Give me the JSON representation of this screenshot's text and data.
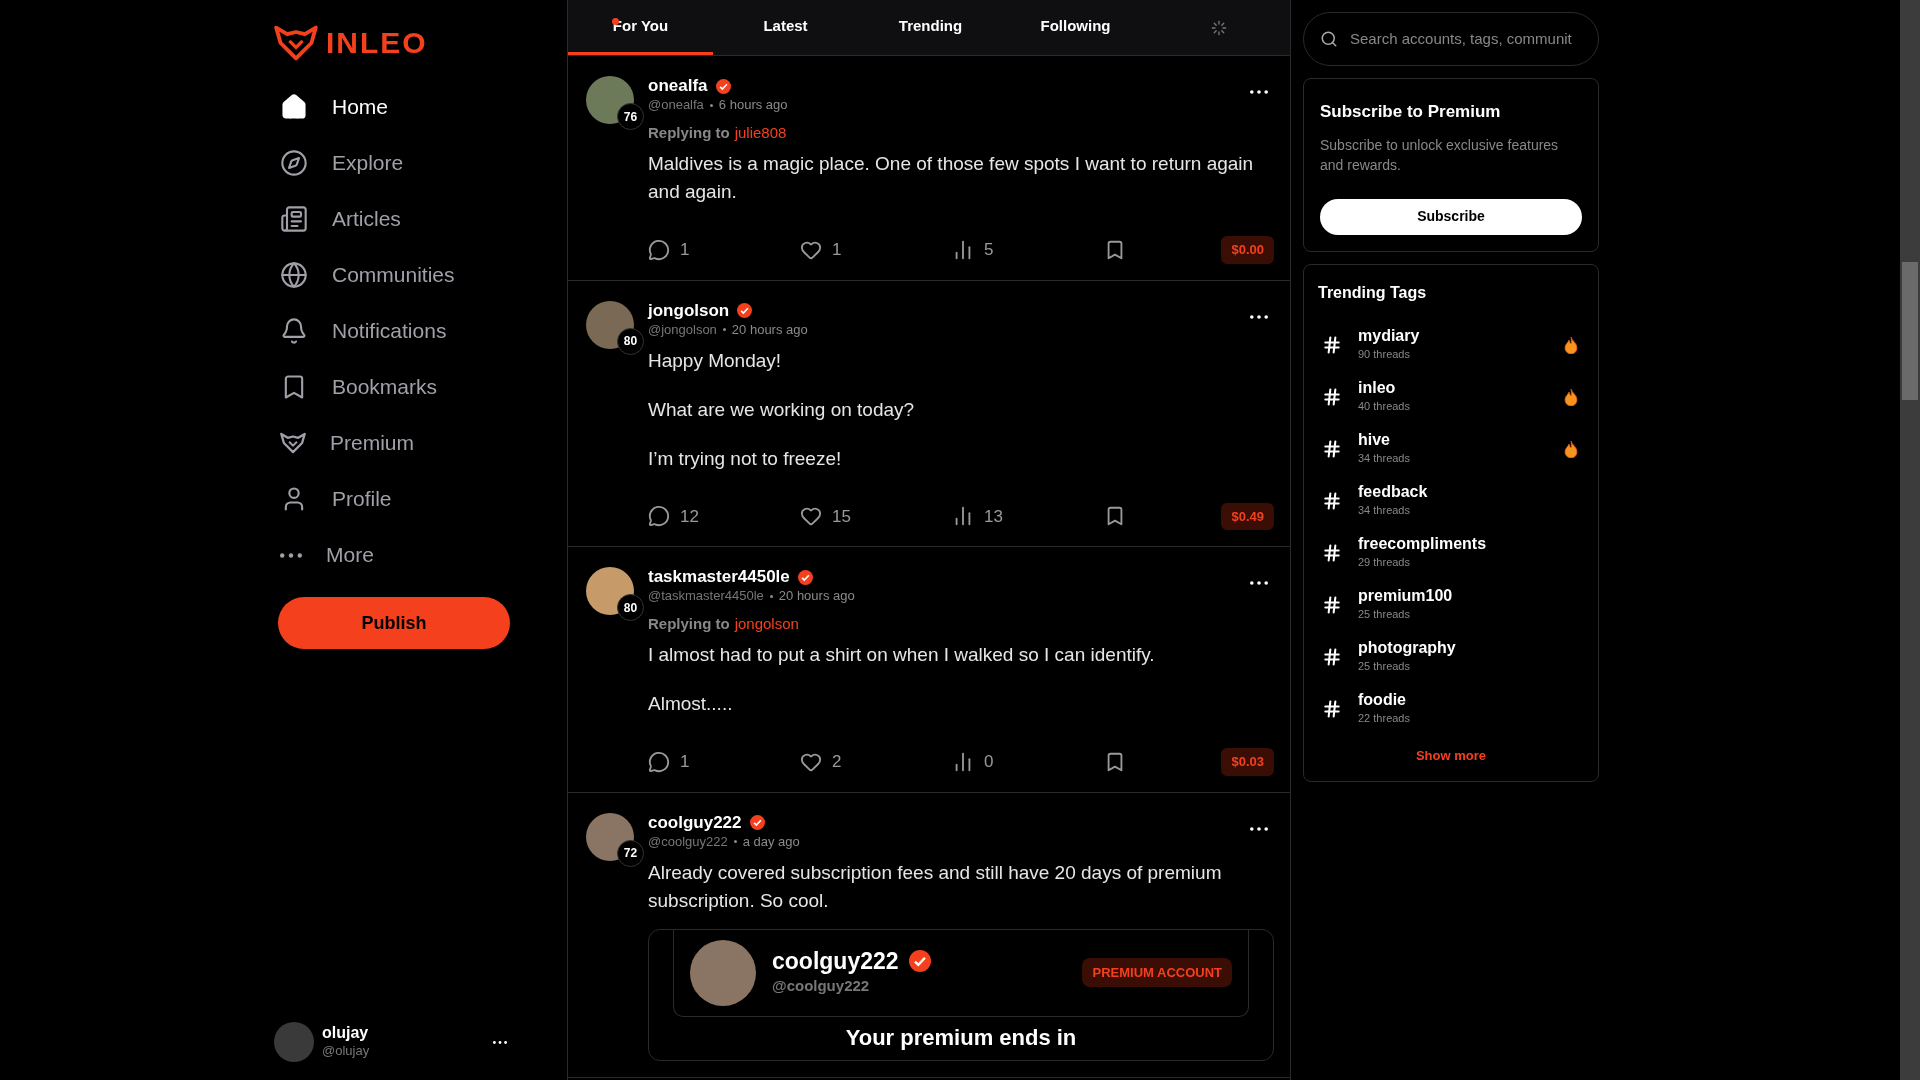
{
  "logo": {
    "text": "INLEO"
  },
  "nav": [
    {
      "kind": "home",
      "label": "Home",
      "selected": true
    },
    {
      "kind": "explore",
      "label": "Explore",
      "selected": false
    },
    {
      "kind": "articles",
      "label": "Articles",
      "selected": false
    },
    {
      "kind": "communities",
      "label": "Communities",
      "selected": false
    },
    {
      "kind": "notifications",
      "label": "Notifications",
      "selected": false
    },
    {
      "kind": "bookmarks",
      "label": "Bookmarks",
      "selected": false
    },
    {
      "kind": "premium",
      "label": "Premium",
      "selected": false
    },
    {
      "kind": "profile",
      "label": "Profile",
      "selected": false
    },
    {
      "kind": "more",
      "label": "More",
      "selected": false
    }
  ],
  "publish_button": "Publish",
  "current_user": {
    "name": "olujay",
    "handle": "@olujay"
  },
  "feed_tabs": [
    {
      "label": "For You",
      "selected": true,
      "unread": true
    },
    {
      "label": "Latest",
      "selected": false,
      "unread": false
    },
    {
      "label": "Trending",
      "selected": false,
      "unread": false
    },
    {
      "label": "Following",
      "selected": false,
      "unread": false
    }
  ],
  "posts": [
    {
      "author": "onealfa",
      "verified": true,
      "handle": "@onealfa",
      "time": "6 hours ago",
      "reputation": "76",
      "replying_label": "Replying to",
      "replying_to": "julie808",
      "paragraphs": [
        "Maldives is a magic place. One of those few spots I want to return again and again."
      ],
      "comments": "1",
      "likes": "1",
      "votes": "5",
      "payout": "$0.00"
    },
    {
      "author": "jongolson",
      "verified": true,
      "handle": "@jongolson",
      "time": "20 hours ago",
      "reputation": "80",
      "paragraphs": [
        "Happy Monday!",
        "What are we working on today?",
        "I’m trying not to freeze!"
      ],
      "comments": "12",
      "likes": "15",
      "votes": "13",
      "payout": "$0.49"
    },
    {
      "author": "taskmaster4450le",
      "verified": true,
      "handle": "@taskmaster4450le",
      "time": "20 hours ago",
      "reputation": "80",
      "replying_label": "Replying to",
      "replying_to": "jongolson",
      "paragraphs": [
        "I almost had to put a shirt on when I walked so I can identify.",
        "Almost....."
      ],
      "comments": "1",
      "likes": "2",
      "votes": "0",
      "payout": "$0.03"
    },
    {
      "author": "coolguy222",
      "verified": true,
      "handle": "@coolguy222",
      "time": "a day ago",
      "reputation": "72",
      "paragraphs": [
        "Already covered subscription fees and still have 20 days of premium subscription. So cool."
      ],
      "embed": {
        "name": "coolguy222",
        "verified": true,
        "handle": "@coolguy222",
        "badge": "PREMIUM ACCOUNT",
        "caption": "Your premium ends in"
      }
    }
  ],
  "search": {
    "placeholder": "Search accounts, tags, communit"
  },
  "premium_card": {
    "title": "Subscribe to Premium",
    "description": "Subscribe to unlock exclusive features and rewards.",
    "button": "Subscribe"
  },
  "trending": {
    "title": "Trending Tags",
    "tags": [
      {
        "name": "mydiary",
        "threads": "90 threads",
        "hot": true
      },
      {
        "name": "inleo",
        "threads": "40 threads",
        "hot": true
      },
      {
        "name": "hive",
        "threads": "34 threads",
        "hot": true
      },
      {
        "name": "feedback",
        "threads": "34 threads",
        "hot": false
      },
      {
        "name": "freecompliments",
        "threads": "29 threads",
        "hot": false
      },
      {
        "name": "premium100",
        "threads": "25 threads",
        "hot": false
      },
      {
        "name": "photography",
        "threads": "25 threads",
        "hot": false
      },
      {
        "name": "foodie",
        "threads": "22 threads",
        "hot": false
      }
    ],
    "show_more": "Show more"
  }
}
